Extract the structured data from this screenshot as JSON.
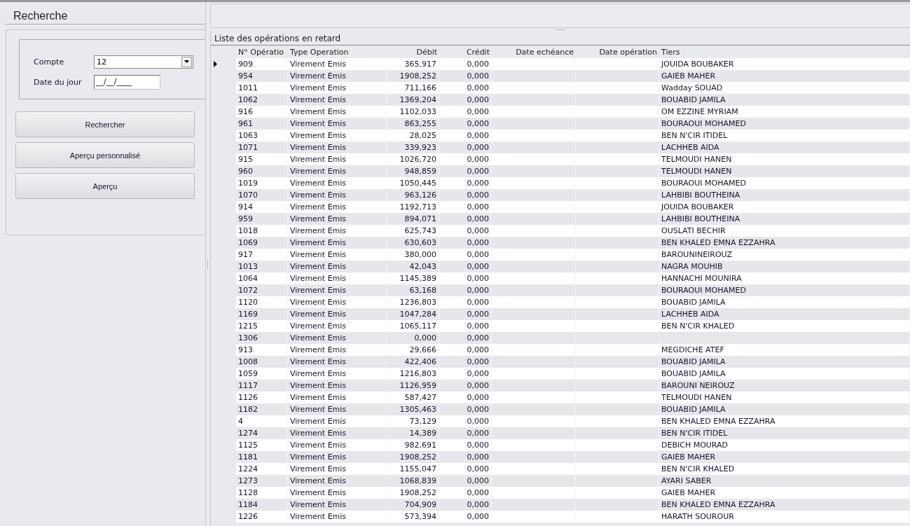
{
  "search_panel": {
    "title": "Recherche",
    "fields": [
      {
        "label": "Compte",
        "kind": "dropdown",
        "value": "12"
      },
      {
        "label": "Date du jour",
        "kind": "masked",
        "value": "__/__/____"
      }
    ],
    "buttons": [
      "Rechercher",
      "Aperçu personnalisé",
      "Aperçu"
    ]
  },
  "table": {
    "title": "Liste des opérations en retard",
    "columns": [
      "N° Opératio",
      "Type Operation",
      "Débit",
      "Crédit",
      "Date echéance",
      "Date opération",
      "Tiers"
    ],
    "rows": [
      {
        "num": "909",
        "type": "Virement Emis",
        "debit": "365,917",
        "credit": "0,000",
        "tiers": "JOUIDA BOUBAKER",
        "selected": true
      },
      {
        "num": "954",
        "type": "Virement Emis",
        "debit": "1908,252",
        "credit": "0,000",
        "tiers": "GAIEB MAHER",
        "selected": false
      },
      {
        "num": "1011",
        "type": "Virement Emis",
        "debit": "711,166",
        "credit": "0,000",
        "tiers": "Wadday SOUAD",
        "selected": false
      },
      {
        "num": "1062",
        "type": "Virement Emis",
        "debit": "1369,204",
        "credit": "0,000",
        "tiers": "BOUABID JAMILA",
        "selected": false
      },
      {
        "num": "916",
        "type": "Virement Emis",
        "debit": "1102,033",
        "credit": "0,000",
        "tiers": "OM EZZINE MYRIAM",
        "selected": false
      },
      {
        "num": "961",
        "type": "Virement Emis",
        "debit": "863,255",
        "credit": "0,000",
        "tiers": "BOURAOUI MOHAMED",
        "selected": false
      },
      {
        "num": "1063",
        "type": "Virement Emis",
        "debit": "28,025",
        "credit": "0,000",
        "tiers": "BEN N'CIR ITIDEL",
        "selected": false
      },
      {
        "num": "1071",
        "type": "Virement Emis",
        "debit": "339,923",
        "credit": "0,000",
        "tiers": "LACHHEB AIDA",
        "selected": false
      },
      {
        "num": "915",
        "type": "Virement Emis",
        "debit": "1026,720",
        "credit": "0,000",
        "tiers": "TELMOUDI HANEN",
        "selected": false
      },
      {
        "num": "960",
        "type": "Virement Emis",
        "debit": "948,859",
        "credit": "0,000",
        "tiers": "TELMOUDI HANEN",
        "selected": false
      },
      {
        "num": "1019",
        "type": "Virement Emis",
        "debit": "1050,445",
        "credit": "0,000",
        "tiers": "BOURAOUI MOHAMED",
        "selected": false
      },
      {
        "num": "1070",
        "type": "Virement Emis",
        "debit": "963,126",
        "credit": "0,000",
        "tiers": "LAHBIBI BOUTHEINA",
        "selected": false
      },
      {
        "num": "914",
        "type": "Virement Emis",
        "debit": "1192,713",
        "credit": "0,000",
        "tiers": "JOUIDA BOUBAKER",
        "selected": false
      },
      {
        "num": "959",
        "type": "Virement Emis",
        "debit": "894,071",
        "credit": "0,000",
        "tiers": "LAHBIBI BOUTHEINA",
        "selected": false
      },
      {
        "num": "1018",
        "type": "Virement Emis",
        "debit": "625,743",
        "credit": "0,000",
        "tiers": "OUSLATI  BECHIR",
        "selected": false
      },
      {
        "num": "1069",
        "type": "Virement Emis",
        "debit": "630,603",
        "credit": "0,000",
        "tiers": "BEN KHALED EMNA EZZAHRA",
        "selected": false
      },
      {
        "num": "917",
        "type": "Virement Emis",
        "debit": "380,000",
        "credit": "0,000",
        "tiers": "BAROUNINEIROUZ",
        "selected": false
      },
      {
        "num": "1013",
        "type": "Virement Emis",
        "debit": "42,043",
        "credit": "0,000",
        "tiers": "NAGRA MOUHIB",
        "selected": false
      },
      {
        "num": "1064",
        "type": "Virement Emis",
        "debit": "1145,389",
        "credit": "0,000",
        "tiers": "HANNACHI MOUNIRA",
        "selected": false
      },
      {
        "num": "1072",
        "type": "Virement Emis",
        "debit": "63,168",
        "credit": "0,000",
        "tiers": "BOURAOUI MOHAMED",
        "selected": false
      },
      {
        "num": "1120",
        "type": "Virement Emis",
        "debit": "1236,803",
        "credit": "0,000",
        "tiers": "BOUABID JAMILA",
        "selected": false
      },
      {
        "num": "1169",
        "type": "Virement Emis",
        "debit": "1047,284",
        "credit": "0,000",
        "tiers": "LACHHEB AIDA",
        "selected": false
      },
      {
        "num": "1215",
        "type": "Virement Emis",
        "debit": "1065,117",
        "credit": "0,000",
        "tiers": "BEN N'CIR KHALED",
        "selected": false
      },
      {
        "num": "1306",
        "type": "Virement Emis",
        "debit": "0,000",
        "credit": "0,000",
        "selected": false
      },
      {
        "num": "913",
        "type": "Virement Emis",
        "debit": "29,666",
        "credit": "0,000",
        "tiers": "MEGDICHE ATEF",
        "selected": false
      },
      {
        "num": "1008",
        "type": "Virement Emis",
        "debit": "422,406",
        "credit": "0,000",
        "tiers": "BOUABID JAMILA",
        "selected": false
      },
      {
        "num": "1059",
        "type": "Virement Emis",
        "debit": "1216,803",
        "credit": "0,000",
        "tiers": "BOUABID JAMILA",
        "selected": false
      },
      {
        "num": "1117",
        "type": "Virement Emis",
        "debit": "1126,959",
        "credit": "0,000",
        "tiers": "BAROUNI NEIROUZ",
        "selected": false
      },
      {
        "num": "1126",
        "type": "Virement Emis",
        "debit": "587,427",
        "credit": "0,000",
        "tiers": "TELMOUDI HANEN",
        "selected": false
      },
      {
        "num": "1182",
        "type": "Virement Emis",
        "debit": "1305,463",
        "credit": "0,000",
        "tiers": "BOUABID JAMILA",
        "selected": false
      },
      {
        "num": "4",
        "type": "Virement Emis",
        "debit": "73,129",
        "credit": "0,000",
        "tiers": "BEN KHALED EMNA EZZAHRA",
        "selected": false
      },
      {
        "num": "1274",
        "type": "Virement Emis",
        "debit": "14,389",
        "credit": "0,000",
        "tiers": "BEN N'CIR ITIDEL",
        "selected": false
      },
      {
        "num": "1125",
        "type": "Virement Emis",
        "debit": "982,691",
        "credit": "0,000",
        "tiers": "DEBICH MOURAD",
        "selected": false
      },
      {
        "num": "1181",
        "type": "Virement Emis",
        "debit": "1908,252",
        "credit": "0,000",
        "tiers": "GAIEB MAHER",
        "selected": false
      },
      {
        "num": "1224",
        "type": "Virement Emis",
        "debit": "1155,047",
        "credit": "0,000",
        "tiers": "BEN N'CIR KHALED",
        "selected": false
      },
      {
        "num": "1273",
        "type": "Virement Emis",
        "debit": "1068,839",
        "credit": "0,000",
        "tiers": "AYARI SABER",
        "selected": false
      },
      {
        "num": "1128",
        "type": "Virement Emis",
        "debit": "1908,252",
        "credit": "0,000",
        "tiers": "GAIEB MAHER",
        "selected": false
      },
      {
        "num": "1184",
        "type": "Virement Emis",
        "debit": "704,909",
        "credit": "0,000",
        "tiers": "BEN KHALED EMNA EZZAHRA",
        "selected": false
      },
      {
        "num": "1226",
        "type": "Virement Emis",
        "debit": "573,394",
        "credit": "0,000",
        "tiers": "HARATH SOUROUR",
        "selected": false
      }
    ]
  }
}
